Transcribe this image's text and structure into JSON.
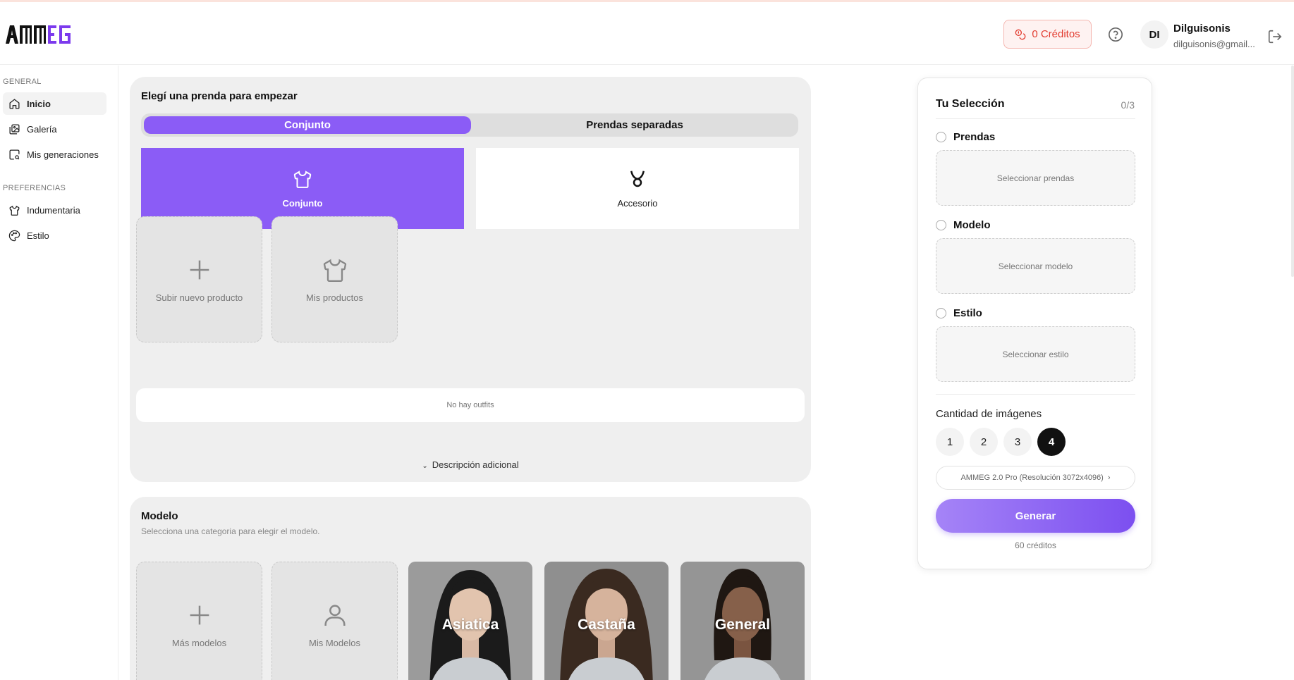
{
  "header": {
    "credits_label": "0 Créditos",
    "avatar_initials": "DI",
    "user_name": "Dilguisonis",
    "user_email": "dilguisonis@gmail..."
  },
  "sidebar": {
    "section_general": "GENERAL",
    "section_preferences": "PREFERENCIAS",
    "items": [
      {
        "label": "Inicio",
        "icon": "home-icon"
      },
      {
        "label": "Galería",
        "icon": "gallery-icon"
      },
      {
        "label": "Mis generaciones",
        "icon": "generations-icon"
      },
      {
        "label": "Indumentaria",
        "icon": "shirt-icon"
      },
      {
        "label": "Estilo",
        "icon": "palette-icon"
      }
    ]
  },
  "garment_panel": {
    "title": "Elegí una prenda para empezar",
    "tabs": [
      "Conjunto",
      "Prendas separadas"
    ],
    "type_cards": [
      {
        "label": "Conjunto",
        "icon": "shirt-icon"
      },
      {
        "label": "Accesorio",
        "icon": "accessory-icon"
      }
    ],
    "upload_label": "Subir nuevo producto",
    "my_products_label": "Mis productos",
    "empty_text": "No hay outfits",
    "extra_description": "Descripción adicional"
  },
  "model_panel": {
    "title": "Modelo",
    "subtitle": "Selecciona una categoria para elegir el modelo.",
    "more_models_label": "Más modelos",
    "my_models_label": "Mis Modelos",
    "categories": [
      "Asiatica",
      "Castaña",
      "General"
    ]
  },
  "selection": {
    "title": "Tu Selección",
    "count": "0/3",
    "prendas_label": "Prendas",
    "prendas_placeholder": "Seleccionar prendas",
    "modelo_label": "Modelo",
    "modelo_placeholder": "Seleccionar modelo",
    "estilo_label": "Estilo",
    "estilo_placeholder": "Seleccionar estilo",
    "quantity_label": "Cantidad de imágenes",
    "quantities": [
      "1",
      "2",
      "3",
      "4"
    ],
    "selected_quantity": "4",
    "model_version": "AMMEG 2.0 Pro (Resolución 3072x4096)",
    "generate_label": "Generar",
    "cost": "60 créditos"
  },
  "colors": {
    "accent": "#8b5cf6",
    "credits_red": "#e23b2f"
  }
}
